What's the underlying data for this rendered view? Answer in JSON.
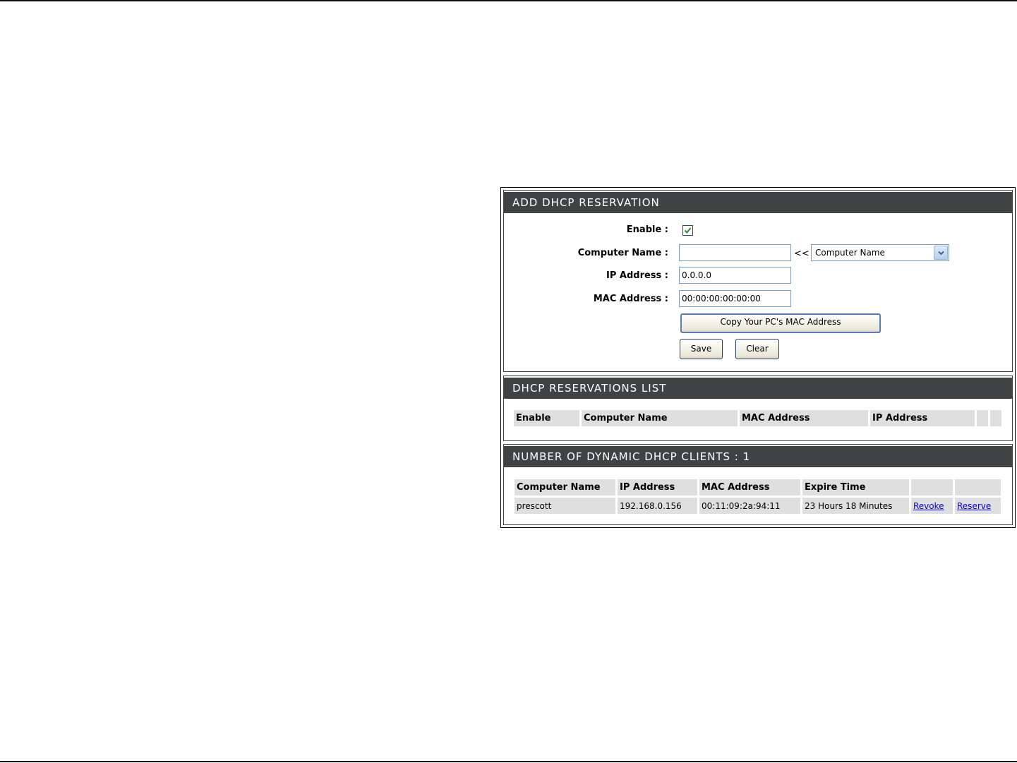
{
  "add_reservation": {
    "title": "ADD DHCP RESERVATION",
    "enable_label": "Enable :",
    "enable_checked": true,
    "computer_name_label": "Computer Name :",
    "computer_name_value": "",
    "arrow_text": "<<",
    "computer_name_select": "Computer Name",
    "ip_label": "IP Address :",
    "ip_value": "0.0.0.0",
    "mac_label": "MAC Address :",
    "mac_value": "00:00:00:00:00:00",
    "copy_mac_button": "Copy Your PC's MAC Address",
    "save_button": "Save",
    "clear_button": "Clear"
  },
  "reservations_list": {
    "title": "DHCP RESERVATIONS LIST",
    "columns": [
      "Enable",
      "Computer Name",
      "MAC Address",
      "IP Address"
    ]
  },
  "dynamic_clients": {
    "title": "NUMBER OF DYNAMIC DHCP CLIENTS : 1",
    "columns": [
      "Computer Name",
      "IP Address",
      "MAC Address",
      "Expire Time"
    ],
    "rows": [
      {
        "computer_name": "prescott",
        "ip_address": "192.168.0.156",
        "mac_address": "00:11:09:2a:94:11",
        "expire_time": "23 Hours 18 Minutes",
        "revoke_label": "Revoke",
        "reserve_label": "Reserve"
      }
    ]
  },
  "colors": {
    "section_bar": "#404343",
    "cell_background": "#dfdfdf",
    "link": "#0000ee",
    "check": "#2a8a2a"
  }
}
